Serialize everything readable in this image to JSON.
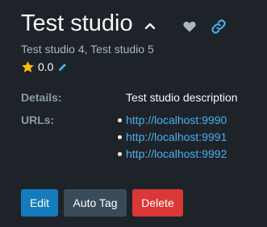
{
  "header": {
    "title": "Test studio",
    "parent_studios": "Test studio 4, Test studio 5"
  },
  "rating": {
    "value": "0.0"
  },
  "details": {
    "label": "Details:",
    "value": "Test studio description"
  },
  "urls": {
    "label": "URLs:",
    "items": [
      "http://localhost:9990",
      "http://localhost:9991",
      "http://localhost:9992"
    ]
  },
  "actions": {
    "edit_label": "Edit",
    "autotag_label": "Auto Tag",
    "delete_label": "Delete"
  },
  "icons": {
    "collapse": "chevron-up-icon",
    "favorite": "heart-icon",
    "link": "link-icon",
    "rating": "star-icon",
    "edit_rating": "pencil-icon"
  },
  "colors": {
    "background": "#1e2329",
    "link": "#48aff0",
    "star": "#ffc107",
    "edit_button": "#137cbd",
    "autotag_button": "#394b59",
    "delete_button": "#db3737"
  }
}
